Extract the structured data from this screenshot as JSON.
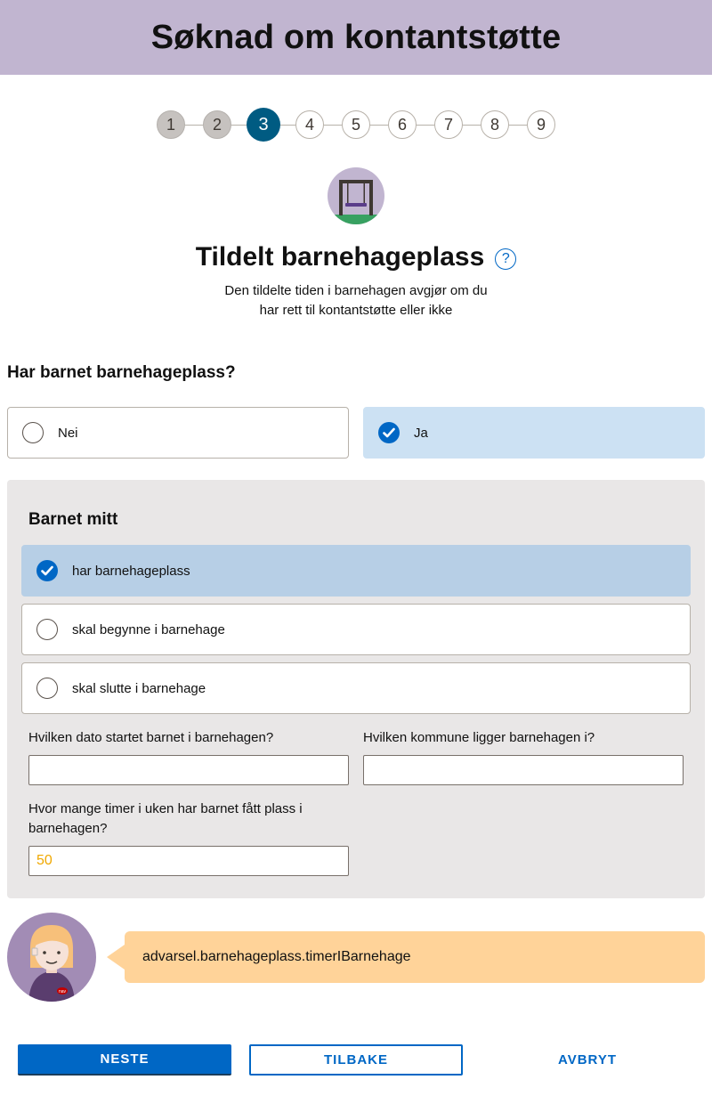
{
  "header": {
    "title": "Søknad om kontantstøtte"
  },
  "stepper": {
    "steps": [
      {
        "label": "1",
        "state": "done"
      },
      {
        "label": "2",
        "state": "done"
      },
      {
        "label": "3",
        "state": "active"
      },
      {
        "label": "4",
        "state": "todo"
      },
      {
        "label": "5",
        "state": "todo"
      },
      {
        "label": "6",
        "state": "todo"
      },
      {
        "label": "7",
        "state": "todo"
      },
      {
        "label": "8",
        "state": "todo"
      },
      {
        "label": "9",
        "state": "todo"
      }
    ]
  },
  "page": {
    "illustration": "barnehage-swing-icon",
    "title": "Tildelt barnehageplass",
    "help_icon": "?",
    "subtitle_line1": "Den tildelte tiden i barnehagen avgjør om du",
    "subtitle_line2": "har rett til kontantstøtte eller ikke"
  },
  "question": {
    "label": "Har barnet barnehageplass?",
    "options": [
      {
        "label": "Nei",
        "checked": false
      },
      {
        "label": "Ja",
        "checked": true
      }
    ]
  },
  "panel": {
    "title": "Barnet mitt",
    "options": [
      {
        "label": "har barnehageplass",
        "checked": true
      },
      {
        "label": "skal begynne i barnehage",
        "checked": false
      },
      {
        "label": "skal slutte i barnehage",
        "checked": false
      }
    ],
    "fields": {
      "start_date": {
        "label": "Hvilken dato startet barnet i barnehagen?",
        "value": ""
      },
      "municipality": {
        "label": "Hvilken kommune ligger barnehagen i?",
        "value": ""
      },
      "hours": {
        "label_line1": "Hvor mange timer i uken har barnet fått plass i",
        "label_line2": "barnehagen?",
        "value": "50"
      }
    }
  },
  "warning": {
    "text": "advarsel.barnehageplass.timerIBarnehage"
  },
  "buttons": {
    "next": "NESTE",
    "back": "TILBAKE",
    "cancel": "AVBRYT"
  },
  "colors": {
    "header_bg": "#c1b5d0",
    "active_step": "#005b82",
    "accent": "#0067c5",
    "warning_bg": "#ffd399",
    "panel_bg": "#e9e7e7"
  }
}
